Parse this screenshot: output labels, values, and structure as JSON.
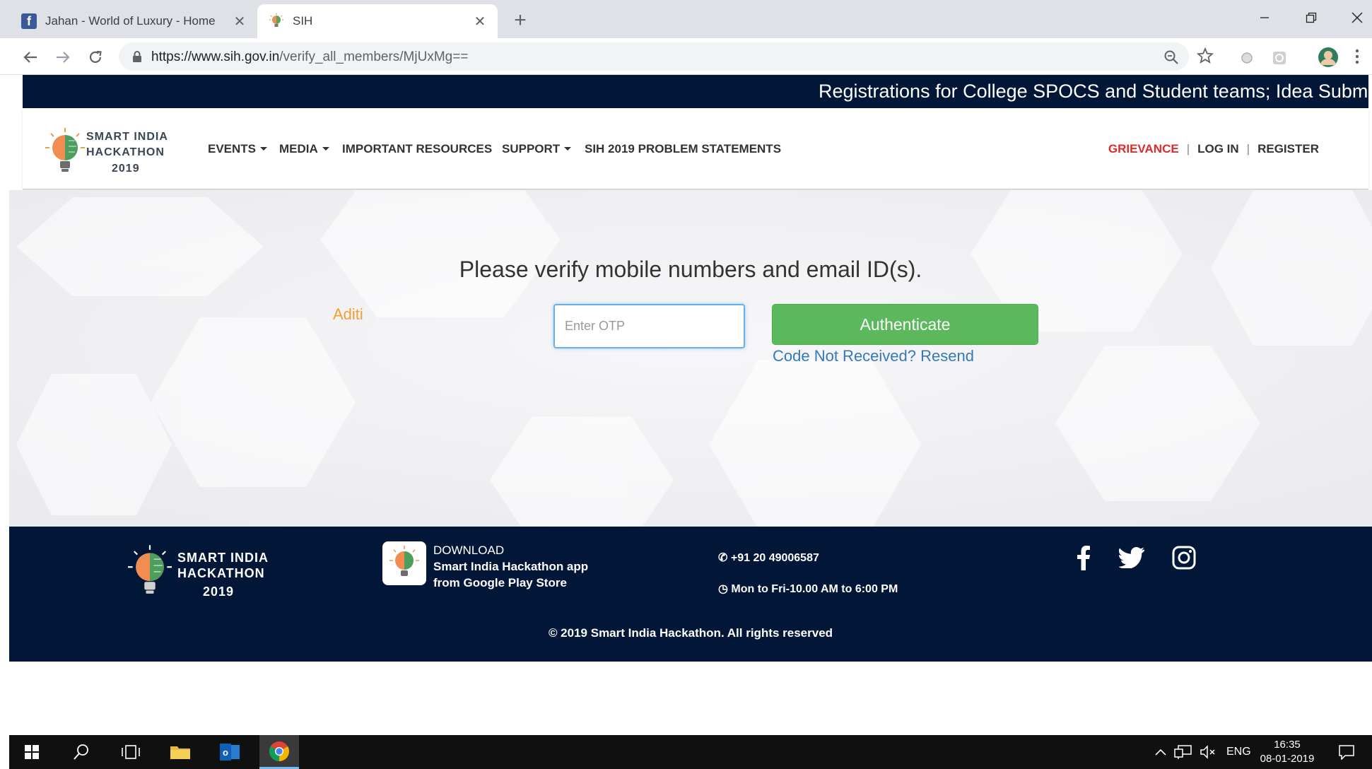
{
  "browser": {
    "tabs": [
      {
        "title": "Jahan - World of Luxury - Home",
        "favicon": "facebook-icon",
        "active": false
      },
      {
        "title": "SIH",
        "favicon": "sih-bulb-icon",
        "active": true
      }
    ],
    "url_host": "https://www.sih.gov.in",
    "url_path": "/verify_all_members/MjUxMg=="
  },
  "site": {
    "ticker_text": "Registrations for College SPOCS and Student teams; Idea Submi",
    "logo": {
      "line1": "SMART INDIA",
      "line2": "HACKATHON",
      "line3": "2019"
    },
    "nav": {
      "events": "EVENTS",
      "media": "MEDIA",
      "resources": "IMPORTANT RESOURCES",
      "support": "SUPPORT",
      "problems": "SIH 2019 PROBLEM STATEMENTS"
    },
    "right_nav": {
      "grievance": "GRIEVANCE",
      "sep": "|",
      "login": "LOG IN",
      "register": "REGISTER"
    },
    "colors": {
      "navy": "#021638",
      "green": "#5cb85c",
      "orange": "#f0a030",
      "link": "#337ab7",
      "red": "#e02b2b"
    }
  },
  "verify": {
    "heading": "Please verify mobile numbers and email ID(s).",
    "member_name": "Aditi",
    "otp_placeholder": "Enter OTP",
    "authenticate_label": "Authenticate",
    "resend_label": "Code Not Received? Resend"
  },
  "footer": {
    "logo": {
      "line1": "SMART INDIA",
      "line2": "HACKATHON",
      "line3": "2019"
    },
    "download": {
      "line1": "DOWNLOAD",
      "line2": "Smart India Hackathon app",
      "line3": "from Google Play Store"
    },
    "phone": "+91 20 49006587",
    "hours": "Mon to Fri-10.00 AM to 6:00 PM",
    "copyright": "© 2019 Smart India Hackathon. All rights reserved",
    "social": [
      "facebook-icon",
      "twitter-icon",
      "instagram-icon"
    ]
  },
  "taskbar": {
    "language": "ENG",
    "time": "16:35",
    "date": "08-01-2019"
  }
}
